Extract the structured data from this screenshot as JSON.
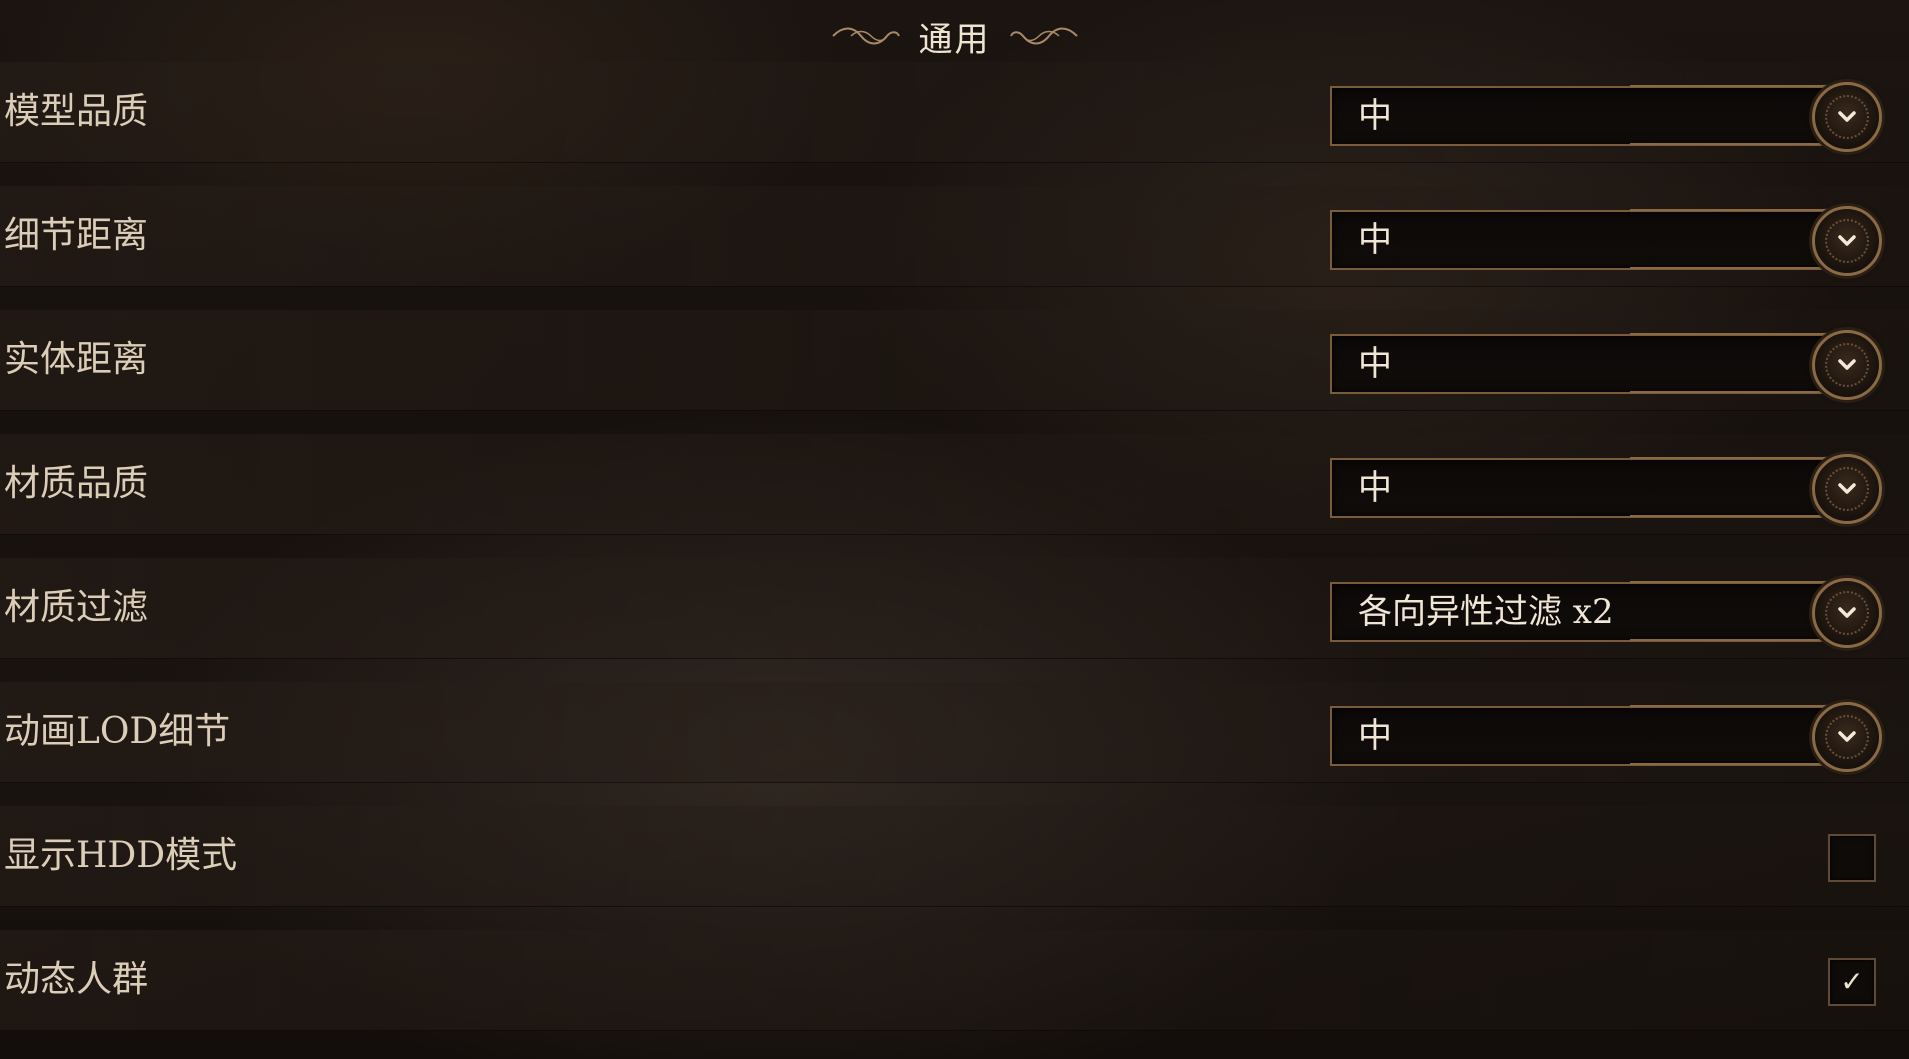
{
  "header": {
    "title": "通用",
    "left_flourish": "flourish-left-icon",
    "right_flourish": "flourish-right-icon"
  },
  "settings": [
    {
      "label": "模型品质",
      "type": "dropdown",
      "value": "中"
    },
    {
      "label": "细节距离",
      "type": "dropdown",
      "value": "中"
    },
    {
      "label": "实体距离",
      "type": "dropdown",
      "value": "中"
    },
    {
      "label": "材质品质",
      "type": "dropdown",
      "value": "中"
    },
    {
      "label": "材质过滤",
      "type": "dropdown",
      "value": "各向异性过滤 x2"
    },
    {
      "label": "动画LOD细节",
      "type": "dropdown",
      "value": "中"
    },
    {
      "label": "显示HDD模式",
      "type": "checkbox",
      "checked": false
    },
    {
      "label": "动态人群",
      "type": "checkbox",
      "checked": true,
      "check_glyph": "✓"
    }
  ],
  "colors": {
    "accent_gold": "#8a6a45",
    "text": "#dccdb8",
    "background": "#17110d"
  }
}
